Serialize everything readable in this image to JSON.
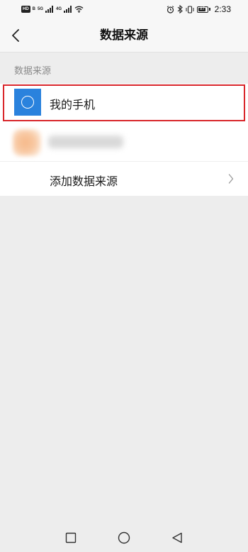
{
  "status_bar": {
    "hd_label": "HD",
    "hd_sub": "B",
    "net1": "5G",
    "net2": "4G",
    "battery_text": "87",
    "battery_level": 0.87,
    "time": "2:33"
  },
  "header": {
    "title": "数据来源",
    "back_icon": "chevron-left-icon"
  },
  "section": {
    "header": "数据来源"
  },
  "list": {
    "items": [
      {
        "label": "我的手机",
        "icon": "phone-circle-icon",
        "highlighted": true
      },
      {
        "label": "",
        "icon": "avatar-blurred",
        "blurred": true
      },
      {
        "label": "添加数据来源",
        "icon": "chevron-right-icon"
      }
    ]
  },
  "nav_bar": {
    "recent_icon": "square-icon",
    "home_icon": "circle-icon",
    "back_icon": "triangle-back-icon"
  },
  "colors": {
    "accent": "#2a82dd",
    "highlight": "#d9262b",
    "background": "#ededed"
  }
}
